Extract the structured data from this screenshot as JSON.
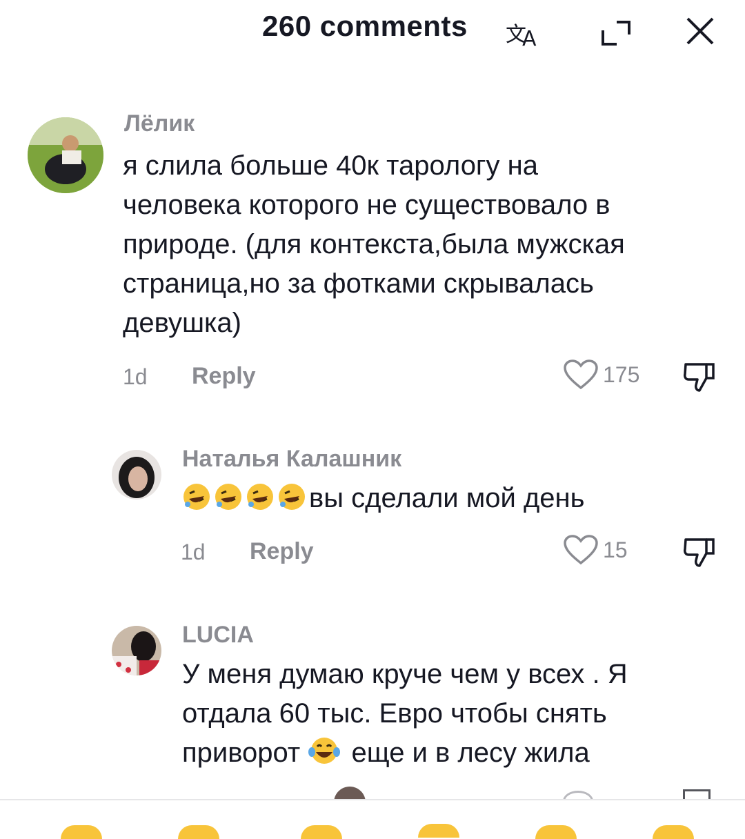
{
  "header": {
    "title": "260 comments",
    "icons": [
      "translate-icon",
      "expand-icon",
      "close-icon"
    ]
  },
  "comments": [
    {
      "username": "Лёлик",
      "lines": [
        "я слила больше 40к тарологу на",
        "человека которого не существовало в",
        "природе. (для контекста,была мужская",
        "страница,но за фотками скрывалась",
        "девушка)"
      ],
      "time": "1d",
      "reply_label": "Reply",
      "likes": "175"
    },
    {
      "username": "Наталья Калашник",
      "text": "вы сделали мой день",
      "emoji": [
        "rofl-emoji",
        "rofl-emoji",
        "rofl-emoji",
        "rofl-emoji"
      ],
      "time": "1d",
      "reply_label": "Reply",
      "likes": "15"
    },
    {
      "username": "LUCIA",
      "lines": [
        "У меня думаю круче чем у всех . Я",
        "отдала 60 тыс. Евро чтобы снять"
      ],
      "line3_before": "приворот",
      "line3_after": "еще и в лесу жила",
      "emoji": [
        "joy-emoji"
      ]
    }
  ],
  "colors": {
    "text": "#161823",
    "secondary": "#8a8b91",
    "emoji_yellow": "#f8c43a"
  }
}
